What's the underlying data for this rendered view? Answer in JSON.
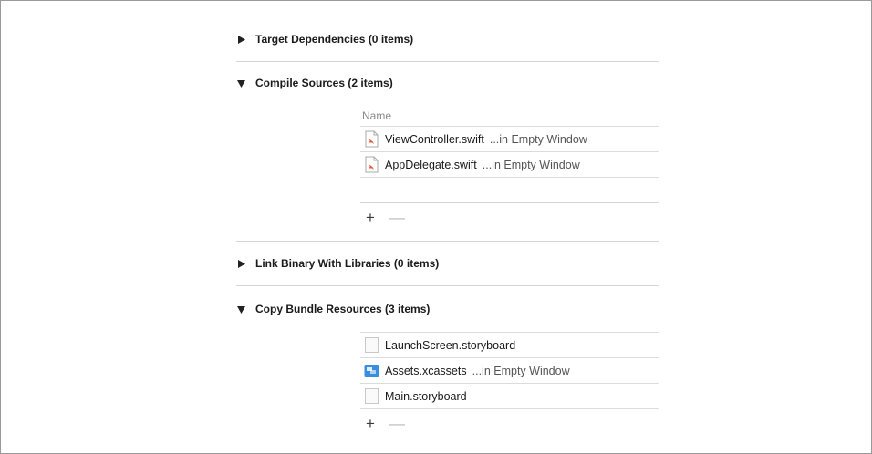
{
  "phases": [
    {
      "title": "Target Dependencies (0 items)",
      "expanded": false
    },
    {
      "title": "Compile Sources (2 items)",
      "expanded": true,
      "column_header": "Name",
      "items": [
        {
          "name": "ViewController.swift",
          "location": "...in Empty Window",
          "icon": "swift-file-icon"
        },
        {
          "name": "AppDelegate.swift",
          "location": "...in Empty Window",
          "icon": "swift-file-icon"
        }
      ]
    },
    {
      "title": "Link Binary With Libraries (0 items)",
      "expanded": false
    },
    {
      "title": "Copy Bundle Resources (3 items)",
      "expanded": true,
      "items": [
        {
          "name": "LaunchScreen.storyboard",
          "location": "",
          "icon": "storyboard-file-icon"
        },
        {
          "name": "Assets.xcassets",
          "location": "...in Empty Window",
          "icon": "asset-catalog-icon"
        },
        {
          "name": "Main.storyboard",
          "location": "",
          "icon": "storyboard-file-icon"
        }
      ]
    }
  ],
  "controls": {
    "add_label": "+",
    "remove_label": "—"
  },
  "colors": {
    "swift_icon": "#e4582e",
    "asset_icon": "#3a8ee0",
    "separator": "#d5d5d5"
  }
}
